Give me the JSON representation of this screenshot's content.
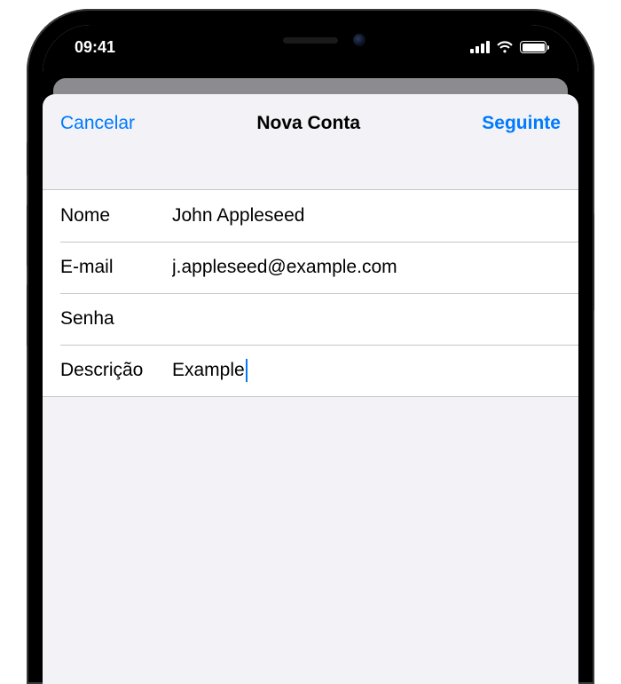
{
  "statusBar": {
    "time": "09:41"
  },
  "sheet": {
    "cancel": "Cancelar",
    "title": "Nova Conta",
    "next": "Seguinte"
  },
  "form": {
    "name": {
      "label": "Nome",
      "value": "John Appleseed"
    },
    "email": {
      "label": "E-mail",
      "value": "j.appleseed@example.com"
    },
    "password": {
      "label": "Senha",
      "value": ""
    },
    "description": {
      "label": "Descrição",
      "value": "Example"
    }
  }
}
